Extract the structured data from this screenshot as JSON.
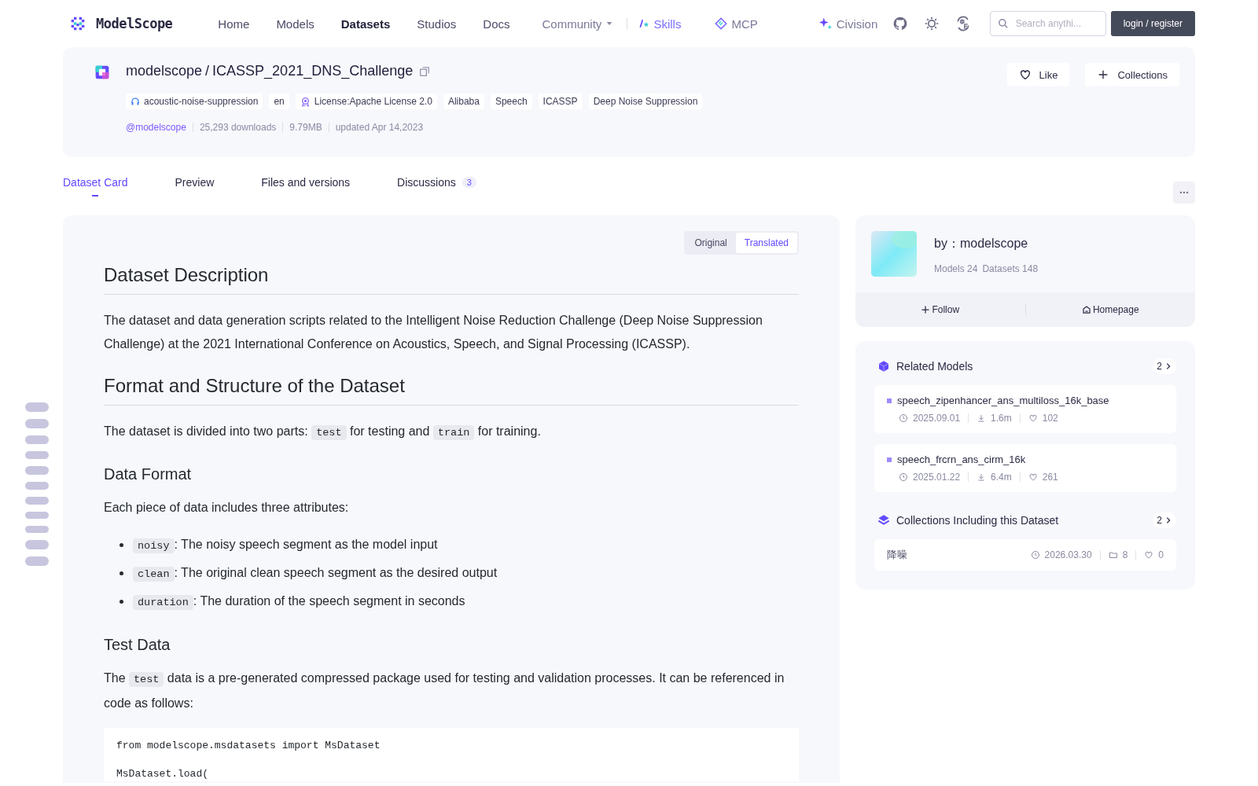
{
  "nav": {
    "logo": "ModelScope",
    "links": [
      {
        "label": "Home",
        "selected": false,
        "kind": "plain"
      },
      {
        "label": "Models",
        "selected": false,
        "kind": "plain"
      },
      {
        "label": "Datasets",
        "selected": true,
        "kind": "plain"
      },
      {
        "label": "Studios",
        "selected": false,
        "kind": "plain"
      },
      {
        "label": "Docs",
        "selected": false,
        "kind": "plain"
      },
      {
        "label": "Community",
        "selected": false,
        "kind": "dropdown"
      },
      {
        "label": "Skills",
        "selected": false,
        "kind": "skills"
      },
      {
        "label": "MCP",
        "selected": false,
        "kind": "mcp"
      },
      {
        "label": "Civision",
        "selected": false,
        "kind": "civision"
      }
    ],
    "search": {
      "placeholder": "Search anythi..."
    },
    "login": "login / register"
  },
  "header": {
    "owner": "modelscope",
    "separator": "/",
    "name": "ICASSP_2021_DNS_Challenge",
    "tags": [
      {
        "label": "acoustic-noise-suppression",
        "kind": "task"
      },
      {
        "label": "en",
        "kind": "plain"
      },
      {
        "label": "License:Apache License 2.0",
        "kind": "license"
      },
      {
        "label": "Alibaba",
        "kind": "plain"
      },
      {
        "label": "Speech",
        "kind": "plain"
      },
      {
        "label": "ICASSP",
        "kind": "plain"
      },
      {
        "label": "Deep Noise Suppression",
        "kind": "plain"
      }
    ],
    "author": "@modelscope",
    "stats": [
      "25,293 downloads",
      "9.79MB",
      "updated Apr 14,2023"
    ],
    "like": "Like",
    "collections": "Collections"
  },
  "tabs": [
    {
      "label": "Dataset Card",
      "selected": true
    },
    {
      "label": "Preview",
      "selected": false
    },
    {
      "label": "Files and versions",
      "selected": false
    },
    {
      "label": "Discussions",
      "selected": false,
      "count": "3"
    }
  ],
  "view_toggle": [
    {
      "label": "Original",
      "selected": false
    },
    {
      "label": "Translated",
      "selected": true
    }
  ],
  "content": [
    {
      "kind": "h1",
      "text": "Dataset Description"
    },
    {
      "kind": "p",
      "parts": [
        {
          "kind": "text",
          "text": "The dataset and data generation scripts related to the Intelligent Noise Reduction Challenge (Deep Noise Suppression Challenge) at the 2021 International Conference on Acoustics, Speech, and Signal Processing (ICASSP)."
        }
      ]
    },
    {
      "kind": "h1",
      "text": "Format and Structure of the Dataset"
    },
    {
      "kind": "p",
      "parts": [
        {
          "kind": "text",
          "text": "The dataset is divided into two parts: "
        },
        {
          "kind": "code",
          "text": "test"
        },
        {
          "kind": "text",
          "text": " for testing and "
        },
        {
          "kind": "code",
          "text": "train"
        },
        {
          "kind": "text",
          "text": " for training."
        }
      ]
    },
    {
      "kind": "h2",
      "text": "Data Format"
    },
    {
      "kind": "p",
      "parts": [
        {
          "kind": "text",
          "text": "Each piece of data includes three attributes:"
        }
      ]
    },
    {
      "kind": "ul",
      "items": [
        [
          {
            "kind": "code",
            "text": "noisy"
          },
          {
            "kind": "text",
            "text": ": The noisy speech segment as the model input"
          }
        ],
        [
          {
            "kind": "code",
            "text": "clean"
          },
          {
            "kind": "text",
            "text": ": The original clean speech segment as the desired output"
          }
        ],
        [
          {
            "kind": "code",
            "text": "duration"
          },
          {
            "kind": "text",
            "text": ": The duration of the speech segment in seconds"
          }
        ]
      ]
    },
    {
      "kind": "h2",
      "text": "Test Data"
    },
    {
      "kind": "p",
      "parts": [
        {
          "kind": "text",
          "text": "The "
        },
        {
          "kind": "code",
          "text": "test"
        },
        {
          "kind": "text",
          "text": " data is a pre-generated compressed package used for testing and validation processes. It can be referenced in code as follows:"
        }
      ]
    },
    {
      "kind": "code",
      "lines": [
        "from modelscope.msdatasets import MsDataset",
        "MsDataset.load("
      ]
    }
  ],
  "author_card": {
    "by": "by：modelscope",
    "stats": [
      "Models 24",
      "Datasets 148"
    ],
    "follow": "Follow",
    "homepage": "Homepage"
  },
  "related_models": {
    "title": "Related Models",
    "count": "2",
    "items": [
      {
        "name": "speech_zipenhancer_ans_multiloss_16k_base",
        "date": "2025.09.01",
        "downloads": "1.6m",
        "likes": "102"
      },
      {
        "name": "speech_frcrn_ans_cirm_16k",
        "date": "2025.01.22",
        "downloads": "6.4m",
        "likes": "261"
      }
    ]
  },
  "collections": {
    "title": "Collections Including this Dataset",
    "count": "2",
    "items": [
      {
        "name": "降噪",
        "date": "2026.03.30",
        "items": "8",
        "likes": "0"
      }
    ]
  }
}
